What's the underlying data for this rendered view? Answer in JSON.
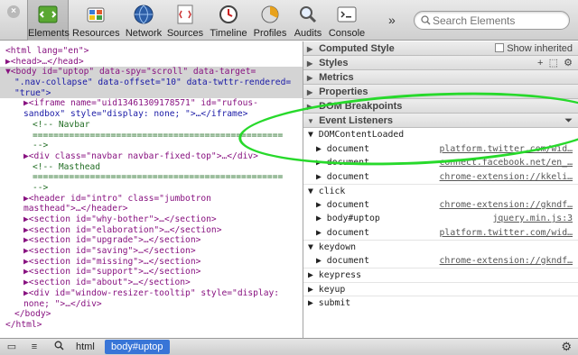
{
  "toolbar": {
    "tools": [
      {
        "label": "Elements",
        "icon": "elements-icon",
        "active": true
      },
      {
        "label": "Resources",
        "icon": "resources-icon"
      },
      {
        "label": "Network",
        "icon": "network-icon"
      },
      {
        "label": "Sources",
        "icon": "sources-icon"
      },
      {
        "label": "Timeline",
        "icon": "timeline-icon"
      },
      {
        "label": "Profiles",
        "icon": "profiles-icon"
      },
      {
        "label": "Audits",
        "icon": "audits-icon"
      },
      {
        "label": "Console",
        "icon": "console-icon"
      }
    ],
    "overflow": "»",
    "close": "×",
    "search_placeholder": "Search Elements"
  },
  "dom": {
    "l00": "<html lang=\"en\">",
    "l01": "▶<head>…</head>",
    "l02": "▼<body id=\"uptop\" data-spy=\"scroll\" data-target=",
    "l03": "\".nav-collapse\" data-offset=\"10\" data-twttr-rendered=",
    "l04": "\"true\">",
    "l05": "▶<iframe name=\"uid13461309178571\" id=\"rufous-",
    "l06": "sandbox\" style=\"display: none; \">…</iframe>",
    "l07": "<!-- Navbar",
    "l08": "================================================",
    "l09": "-->",
    "l10": "▶<div class=\"navbar navbar-fixed-top\">…</div>",
    "l11": "<!-- Masthead",
    "l12": "================================================",
    "l13": "-->",
    "l14": "▶<header id=\"intro\" class=\"jumbotron",
    "l15": "masthead\">…</header>",
    "l16": "▶<section id=\"why-bother\">…</section>",
    "l17": "▶<section id=\"elaboration\">…</section>",
    "l18": "▶<section id=\"upgrade\">…</section>",
    "l19": "▶<section id=\"saving\">…</section>",
    "l20": "▶<section id=\"missing\">…</section>",
    "l21": "▶<section id=\"support\">…</section>",
    "l22": "▶<section id=\"about\">…</section>",
    "l23": "▶<div id=\"window-resizer-tooltip\" style=\"display:",
    "l24": "none; \">…</div>",
    "l25": "</body>",
    "l26": "</html>"
  },
  "sidebar": {
    "computed_style": "Computed Style",
    "show_inherited": "Show inherited",
    "styles": "Styles",
    "metrics": "Metrics",
    "properties": "Properties",
    "dom_breakpoints": "DOM Breakpoints",
    "event_listeners": "Event Listeners",
    "groups": [
      {
        "name": "DOMContentLoaded",
        "expanded": true,
        "rows": [
          {
            "node": "document",
            "source": "platform.twitter.com/wid…"
          },
          {
            "node": "document",
            "source": "connect.facebook.net/en_…"
          },
          {
            "node": "document",
            "source": "chrome-extension://kkeli…"
          }
        ]
      },
      {
        "name": "click",
        "expanded": true,
        "rows": [
          {
            "node": "document",
            "source": "chrome-extension://gkndf…"
          },
          {
            "node": "body#uptop",
            "source": "jquery.min.js:3"
          },
          {
            "node": "document",
            "source": "platform.twitter.com/wid…"
          }
        ]
      },
      {
        "name": "keydown",
        "expanded": true,
        "rows": [
          {
            "node": "document",
            "source": "chrome-extension://gkndf…"
          }
        ]
      },
      {
        "name": "keypress",
        "expanded": false,
        "rows": []
      },
      {
        "name": "keyup",
        "expanded": false,
        "rows": []
      },
      {
        "name": "submit",
        "expanded": false,
        "rows": []
      }
    ]
  },
  "statusbar": {
    "crumb_html": "html",
    "crumb_body": "body#uptop"
  },
  "colors": {
    "accent": "#3875d7",
    "annotation": "#27d92b"
  }
}
